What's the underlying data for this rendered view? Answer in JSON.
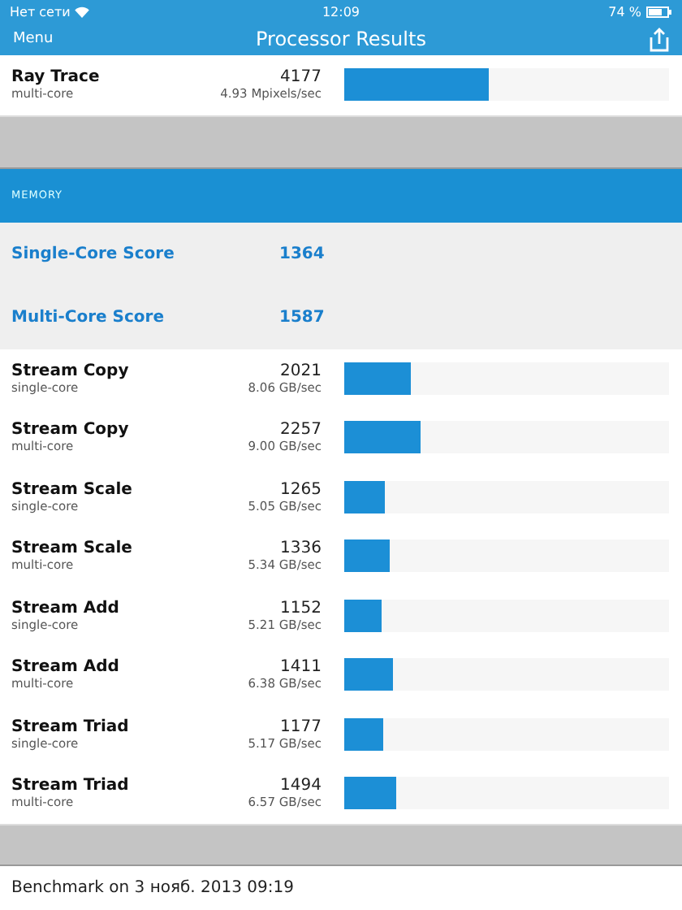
{
  "status_bar": {
    "carrier": "Нет сети",
    "time": "12:09",
    "battery": "74 %"
  },
  "nav": {
    "menu": "Menu",
    "title": "Processor Results"
  },
  "top_rows": [
    {
      "name": "Ray Trace",
      "mode": "multi-core",
      "score": "4177",
      "rate": "4.93 Mpixels/sec",
      "level": 0.445
    }
  ],
  "section": {
    "title": "MEMORY"
  },
  "scores": [
    {
      "label": "Single-Core Score",
      "value": "1364"
    },
    {
      "label": "Multi-Core Score",
      "value": "1587"
    }
  ],
  "rows": [
    {
      "name": "Stream Copy",
      "mode": "single-core",
      "score": "2021",
      "rate": "8.06 GB/sec",
      "level": 0.205
    },
    {
      "name": "Stream Copy",
      "mode": "multi-core",
      "score": "2257",
      "rate": "9.00 GB/sec",
      "level": 0.235
    },
    {
      "name": "Stream Scale",
      "mode": "single-core",
      "score": "1265",
      "rate": "5.05 GB/sec",
      "level": 0.125
    },
    {
      "name": "Stream Scale",
      "mode": "multi-core",
      "score": "1336",
      "rate": "5.34 GB/sec",
      "level": 0.14
    },
    {
      "name": "Stream Add",
      "mode": "single-core",
      "score": "1152",
      "rate": "5.21 GB/sec",
      "level": 0.115
    },
    {
      "name": "Stream Add",
      "mode": "multi-core",
      "score": "1411",
      "rate": "6.38 GB/sec",
      "level": 0.15
    },
    {
      "name": "Stream Triad",
      "mode": "single-core",
      "score": "1177",
      "rate": "5.17 GB/sec",
      "level": 0.12
    },
    {
      "name": "Stream Triad",
      "mode": "multi-core",
      "score": "1494",
      "rate": "6.57 GB/sec",
      "level": 0.16
    }
  ],
  "footer": {
    "text": "Benchmark on 3 нояб. 2013 09:19"
  }
}
